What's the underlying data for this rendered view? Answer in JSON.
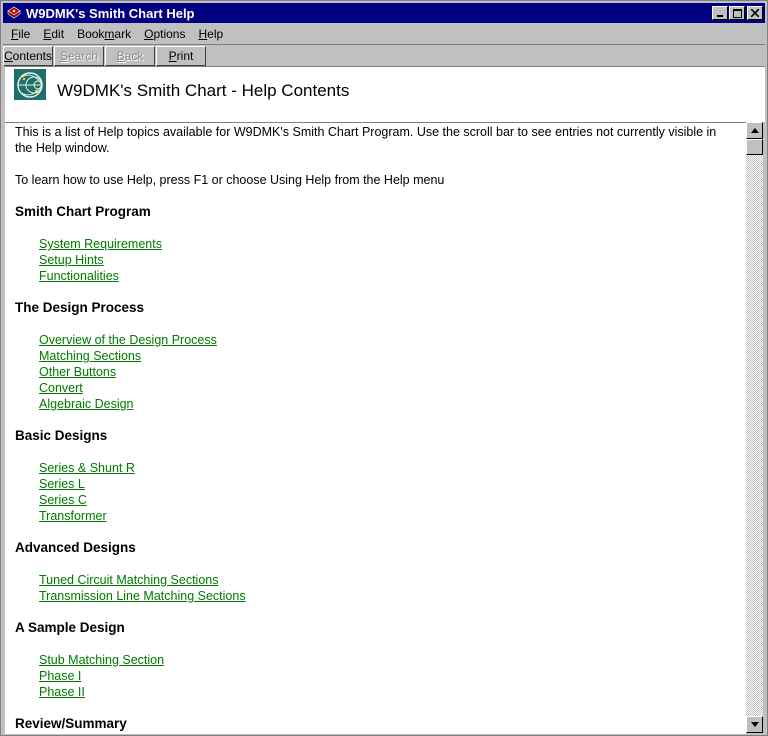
{
  "window": {
    "title": "W9DMK's Smith Chart Help"
  },
  "menu": {
    "items": [
      {
        "pre": "",
        "u": "F",
        "post": "ile"
      },
      {
        "pre": "",
        "u": "E",
        "post": "dit"
      },
      {
        "pre": "Book",
        "u": "m",
        "post": "ark"
      },
      {
        "pre": "",
        "u": "O",
        "post": "ptions"
      },
      {
        "pre": "",
        "u": "H",
        "post": "elp"
      }
    ]
  },
  "toolbar": {
    "buttons": [
      {
        "pre": "",
        "u": "C",
        "post": "ontents",
        "enabled": true
      },
      {
        "pre": "",
        "u": "S",
        "post": "earch",
        "enabled": false
      },
      {
        "pre": "",
        "u": "B",
        "post": "ack",
        "enabled": false
      },
      {
        "pre": "",
        "u": "P",
        "post": "rint",
        "enabled": true
      }
    ]
  },
  "header": {
    "title": "W9DMK's Smith Chart - Help Contents"
  },
  "content": {
    "intro": "This is a  list of Help topics available for W9DMK's Smith Chart Program.  Use the scroll bar to see entries not currently visible in the Help window.",
    "help_note": "To learn how to use Help, press F1 or choose Using Help from the Help menu",
    "sections": [
      {
        "title": "Smith Chart Program",
        "links": [
          "System Requirements",
          "Setup Hints",
          "Functionalities"
        ]
      },
      {
        "title": "The Design Process",
        "links": [
          "Overview of the Design Process",
          "Matching Sections",
          "Other Buttons",
          "Convert",
          "Algebraic Design"
        ]
      },
      {
        "title": "Basic Designs",
        "links": [
          "Series & Shunt R",
          "Series L",
          "Series C",
          "Transformer"
        ]
      },
      {
        "title": "Advanced Designs",
        "links": [
          "Tuned Circuit Matching Sections",
          "Transmission Line Matching Sections"
        ]
      },
      {
        "title": "A Sample Design",
        "links": [
          "Stub Matching Section",
          "Phase I",
          "Phase II"
        ]
      },
      {
        "title": "Review/Summary",
        "links": []
      }
    ]
  },
  "colors": {
    "titlebar": "#000080",
    "link": "#007a00",
    "face": "#c0c0c0"
  }
}
